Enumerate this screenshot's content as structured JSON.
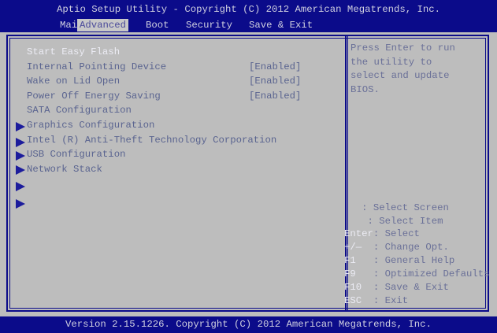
{
  "header": {
    "title": "Aptio Setup Utility - Copyright (C) 2012 American Megatrends, Inc.",
    "tabs": [
      "Main",
      "Advanced",
      "Boot",
      "Security",
      "Save & Exit"
    ],
    "active_tab": "Advanced"
  },
  "items": [
    {
      "label": "Start Easy Flash",
      "value": ""
    },
    {
      "label": "Internal Pointing Device",
      "value": "[Enabled]"
    },
    {
      "label": "Wake on Lid Open",
      "value": "[Enabled]"
    },
    {
      "label": "Power Off Energy Saving",
      "value": "[Enabled]"
    },
    {
      "label": "SATA Configuration",
      "value": ""
    },
    {
      "label": "Graphics Configuration",
      "value": ""
    },
    {
      "label": "Intel (R) Anti-Theft Technology Corporation",
      "value": ""
    },
    {
      "label": "USB Configuration",
      "value": ""
    },
    {
      "label": "Network Stack",
      "value": ""
    }
  ],
  "help": "Press Enter to run\nthe utility to\nselect and update\nBIOS.",
  "keys": [
    {
      "key": "",
      "desc": "   : Select Screen"
    },
    {
      "key": "",
      "desc": "    : Select Item"
    },
    {
      "key": "Enter",
      "desc": ": Select"
    },
    {
      "key": "+/—",
      "desc": "  : Change Opt."
    },
    {
      "key": "F1",
      "desc": "   : General Help"
    },
    {
      "key": "F9",
      "desc": "   : Optimized Defaults"
    },
    {
      "key": "F10",
      "desc": "  : Save & Exit"
    },
    {
      "key": "ESC",
      "desc": "  : Exit"
    }
  ],
  "footer": "Version 2.15.1226. Copyright (C) 2012 American Megatrends, Inc."
}
